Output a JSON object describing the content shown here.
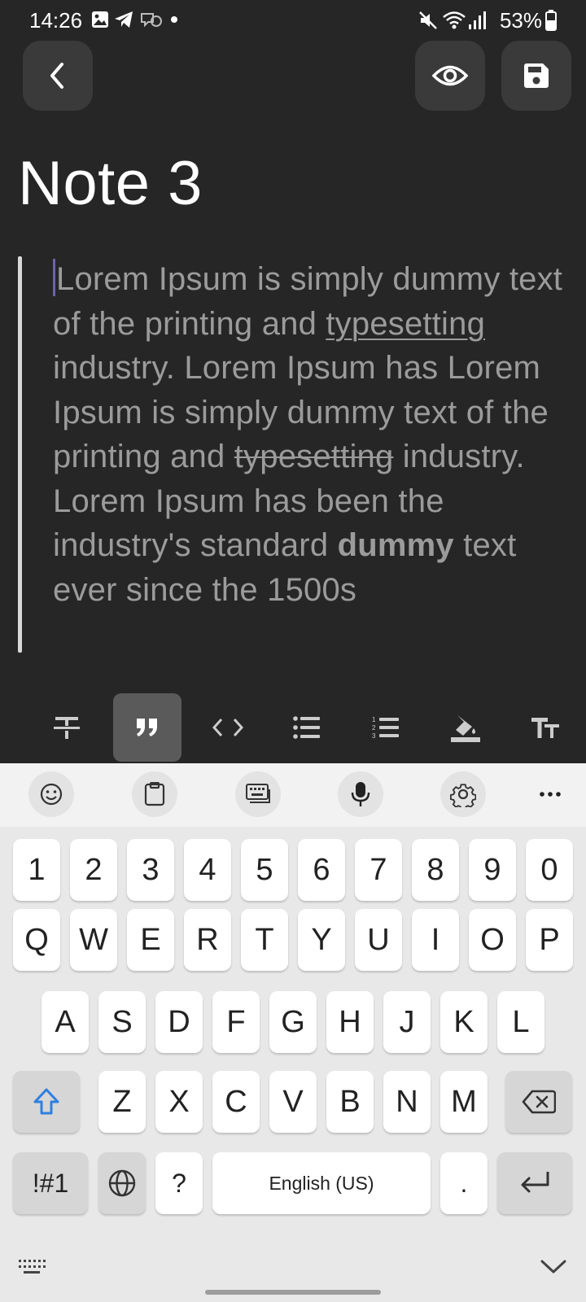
{
  "status_bar": {
    "time": "14:26",
    "battery": "53%",
    "left_icons": [
      "gallery-icon",
      "telegram-icon",
      "voicemail-icon",
      "dot-icon"
    ],
    "right_icons": [
      "mute-icon",
      "wifi-icon",
      "signal-icon",
      "battery-icon"
    ]
  },
  "header": {
    "back_icon": "back-arrow-icon",
    "preview_icon": "eye-icon",
    "save_icon": "save-icon"
  },
  "note": {
    "title": "Note 3",
    "segments": {
      "p1": "Lorem Ipsum is simply dummy text of the printing and ",
      "u1": "typesetting",
      "p2": " industry. Lorem Ipsum has Lorem Ipsum is simply dummy text of the printing and ",
      "s1": "typesetting",
      "p3": " industry. Lorem Ipsum has been the industry's standard ",
      "b1": "dummy",
      "p4": " text ever since the 1500s"
    }
  },
  "format_toolbar": {
    "items": [
      {
        "name": "strikethrough",
        "icon": "strikethrough-icon",
        "active": false
      },
      {
        "name": "quote",
        "icon": "quote-icon",
        "active": true
      },
      {
        "name": "code",
        "icon": "code-icon",
        "active": false
      },
      {
        "name": "bulleted-list",
        "icon": "bulleted-list-icon",
        "active": false
      },
      {
        "name": "numbered-list",
        "icon": "numbered-list-icon",
        "active": false
      },
      {
        "name": "text-color",
        "icon": "paint-bucket-icon",
        "active": false
      },
      {
        "name": "text-size",
        "icon": "text-size-icon",
        "active": false
      }
    ]
  },
  "keyboard": {
    "toolbar_icons": [
      "emoji-icon",
      "clipboard-icon",
      "keyboard-layout-icon",
      "microphone-icon",
      "settings-icon",
      "more-icon"
    ],
    "row_numbers": [
      "1",
      "2",
      "3",
      "4",
      "5",
      "6",
      "7",
      "8",
      "9",
      "0"
    ],
    "row_1": [
      "Q",
      "W",
      "E",
      "R",
      "T",
      "Y",
      "U",
      "I",
      "O",
      "P"
    ],
    "row_2": [
      "A",
      "S",
      "D",
      "F",
      "G",
      "H",
      "J",
      "K",
      "L"
    ],
    "row_3": [
      "Z",
      "X",
      "C",
      "V",
      "B",
      "N",
      "M"
    ],
    "symbols_label": "!#1",
    "question_label": "?",
    "space_label": "English (US)",
    "period_label": ".",
    "shift_icon": "shift-icon",
    "backspace_icon": "backspace-icon",
    "globe_icon": "globe-icon",
    "enter_icon": "enter-icon",
    "bottom_left_icon": "keyboard-hide-icon",
    "bottom_right_icon": "chevron-down-icon",
    "accent_color": "#2f7fe0"
  }
}
